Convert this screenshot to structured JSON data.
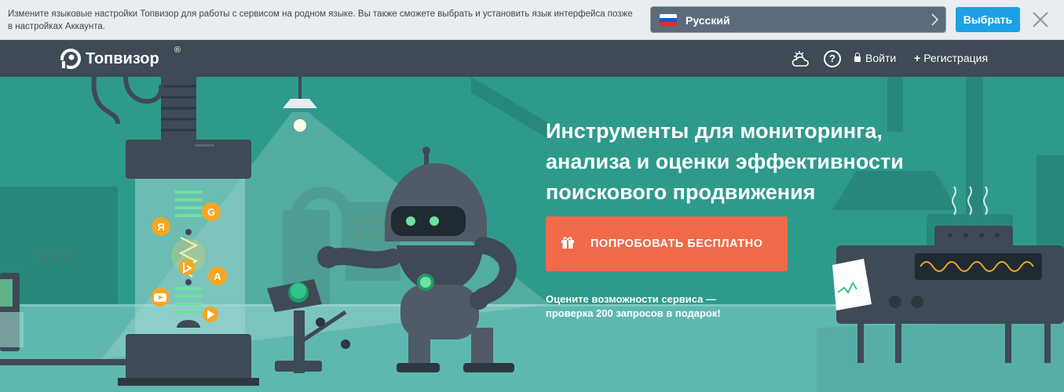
{
  "language_banner": {
    "message": "Измените языковые настройки Топвизор для работы с сервисом на родном языке. Вы также сможете выбрать и установить язык интерфейса позже в настройках Аккаунта.",
    "selected_language": "Русский",
    "choose_label": "Выбрать",
    "flag_colors": [
      "#ffffff",
      "#1c57c8",
      "#e8262d"
    ]
  },
  "header": {
    "logo_text": "Топвизор",
    "logo_mark": "®",
    "login_label": "Войти",
    "register_label": "Регистрация"
  },
  "hero": {
    "title": "Инструменты для мониторинга, анализа и оценки эффективности поискового продвижения",
    "cta_label": "ПОПРОБОВАТЬ БЕСПЛАТНО",
    "promo_text": "Оцените возможности сервиса — проверка 200 запросов в подарок!",
    "colors": {
      "background": "#2e9a8c",
      "cta": "#f06a4a",
      "header": "#3e4a56"
    },
    "engine_icons": [
      "yandex-icon",
      "google-icon",
      "bing-icon",
      "app-store-icon",
      "youtube-icon",
      "google-play-icon"
    ],
    "engine_glyphs": {
      "yandex": "Я",
      "google": "G",
      "app_store": "A"
    }
  }
}
